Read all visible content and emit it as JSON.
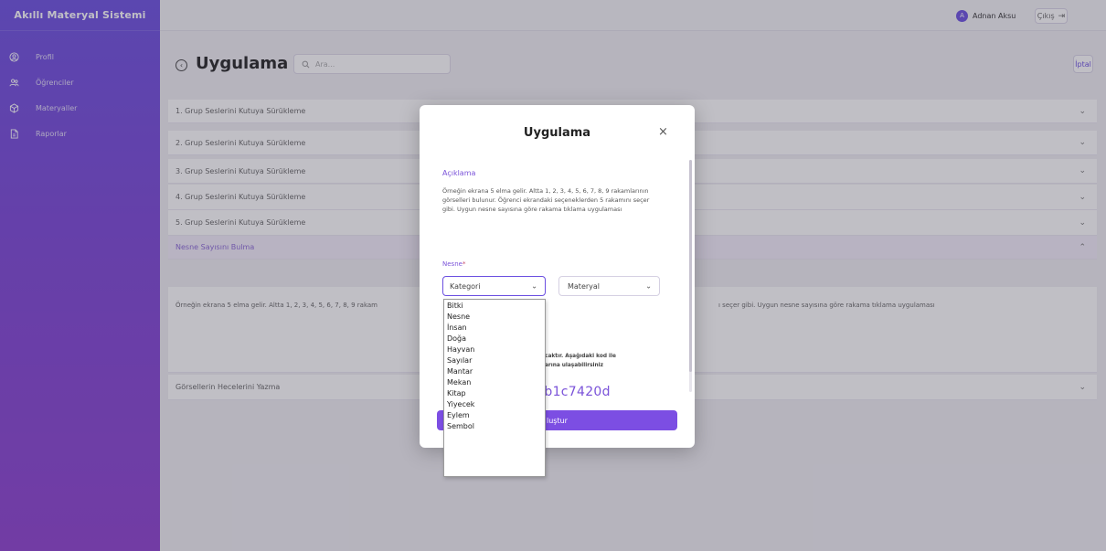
{
  "app": {
    "title": "Akıllı Materyal Sistemi"
  },
  "sidebar": {
    "items": [
      {
        "label": "Profil",
        "icon": "user-circle-icon"
      },
      {
        "label": "Öğrenciler",
        "icon": "users-icon"
      },
      {
        "label": "Materyaller",
        "icon": "box-icon"
      },
      {
        "label": "Raporlar",
        "icon": "file-icon"
      }
    ]
  },
  "topbar": {
    "user_initial": "A",
    "user_name": "Adnan Aksu",
    "logout_label": "Çıkış"
  },
  "header": {
    "title": "Uygulama",
    "search_placeholder": "Ara...",
    "cancel_label": "İptal"
  },
  "accordion": {
    "items": [
      "1. Grup Seslerini Kutuya Sürükleme",
      "2. Grup Seslerini Kutuya Sürükleme",
      "3. Grup Seslerini Kutuya Sürükleme",
      "4. Grup Seslerini Kutuya Sürükleme",
      "5. Grup Seslerini Kutuya Sürükleme",
      "Nesne Sayısını Bulma",
      "Görsellerin Hecelerini Yazma"
    ],
    "open_body_left": "Örneğin ekrana 5 elma gelir. Altta 1, 2, 3, 4, 5, 6, 7, 8, 9 rakam",
    "open_body_right": "ı seçer gibi. Uygun nesne sayısına göre rakama tıklama uygulaması"
  },
  "modal": {
    "title": "Uygulama",
    "close": "×",
    "description_label": "Açıklama",
    "description": "Örneğin ekrana 5 elma gelir. Altta 1, 2, 3, 4, 5, 6, 7, 8, 9 rakamlarının görselleri bulunur. Öğrenci ekrandaki seçeneklerden 5 rakamını seçer gibi. Uygun nesne sayısına göre rakama tıklama uygulaması",
    "object_label": "Nesne",
    "required_mark": "*",
    "category_value": "Kategori",
    "material_value": "Materyal",
    "info_line1": "onacaktır. Aşağıdaki kod ile",
    "info_line2": "malarına ulaşabilirsiniz",
    "code_text": "74b1c7420d",
    "create_label": "luştur"
  },
  "dropdown": {
    "options": [
      "Bitki",
      "Nesne",
      "İnsan",
      "Doğa",
      "Hayvan",
      "Sayılar",
      "Mantar",
      "Mekan",
      "Kitap",
      "Yiyecek",
      "Eylem",
      "Sembol"
    ]
  }
}
